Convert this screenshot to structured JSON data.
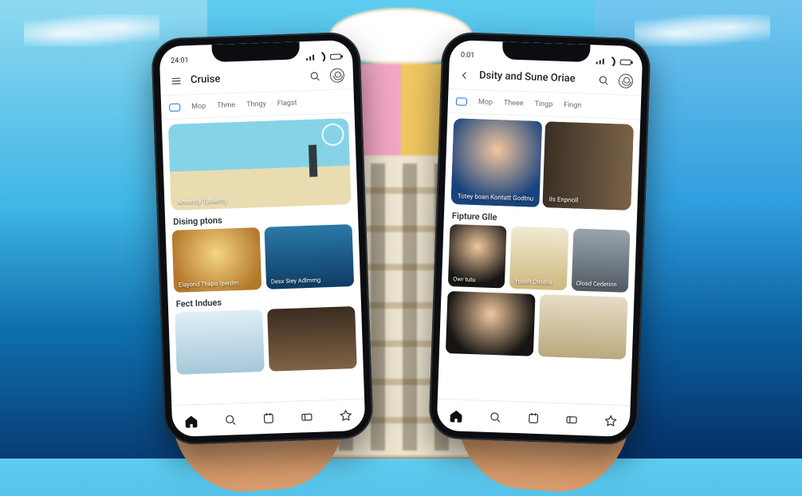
{
  "phones": {
    "left": {
      "status_time": "24:01",
      "appbar_title": "Cruise",
      "tabs": [
        {
          "label": "",
          "active": true
        },
        {
          "label": "Mop"
        },
        {
          "label": "Thme"
        },
        {
          "label": "Thngy"
        },
        {
          "label": "Flagst"
        }
      ],
      "hero": {
        "caption": "Amernty\nTpolerny"
      },
      "sections": [
        {
          "title": "Dising ptons",
          "cards": [
            {
              "label": "Elayond\nThapo fperdm",
              "bg": "g-room"
            },
            {
              "label": "Desx  Siey Adlmmg",
              "bg": "g-sea"
            }
          ]
        },
        {
          "title": "Fect Indues",
          "cards": [
            {
              "label": "",
              "bg": "g-sail"
            },
            {
              "label": "",
              "bg": "g-dine"
            }
          ]
        }
      ]
    },
    "right": {
      "status_time": "0:01",
      "appbar_title": "Dsity and Sune Oriae",
      "tabs": [
        {
          "label": "",
          "active": true
        },
        {
          "label": "Mop"
        },
        {
          "label": "Theee"
        },
        {
          "label": "Tingp"
        },
        {
          "label": "Fingn"
        }
      ],
      "hero_split": [
        {
          "label": "Totey boan\nKontatt Godtnu",
          "bg": "g-selfie"
        },
        {
          "label": "Ils\nEnpnoll",
          "bg": "g-balc"
        }
      ],
      "sections": [
        {
          "title": "Fipture Glle",
          "cards": [
            {
              "label": "Owr tutu",
              "bg": "g-girl"
            },
            {
              "label": "Youslt\nCtrolna",
              "bg": "g-hall"
            },
            {
              "label": "Olosd\nCedetinn",
              "bg": "g-mach"
            }
          ]
        },
        {
          "title": "",
          "cards": [
            {
              "label": "",
              "bg": "g-girl"
            },
            {
              "label": "",
              "bg": "g-desk"
            }
          ]
        }
      ]
    }
  },
  "nav_items": [
    "home",
    "search",
    "collections",
    "tickets",
    "star"
  ]
}
